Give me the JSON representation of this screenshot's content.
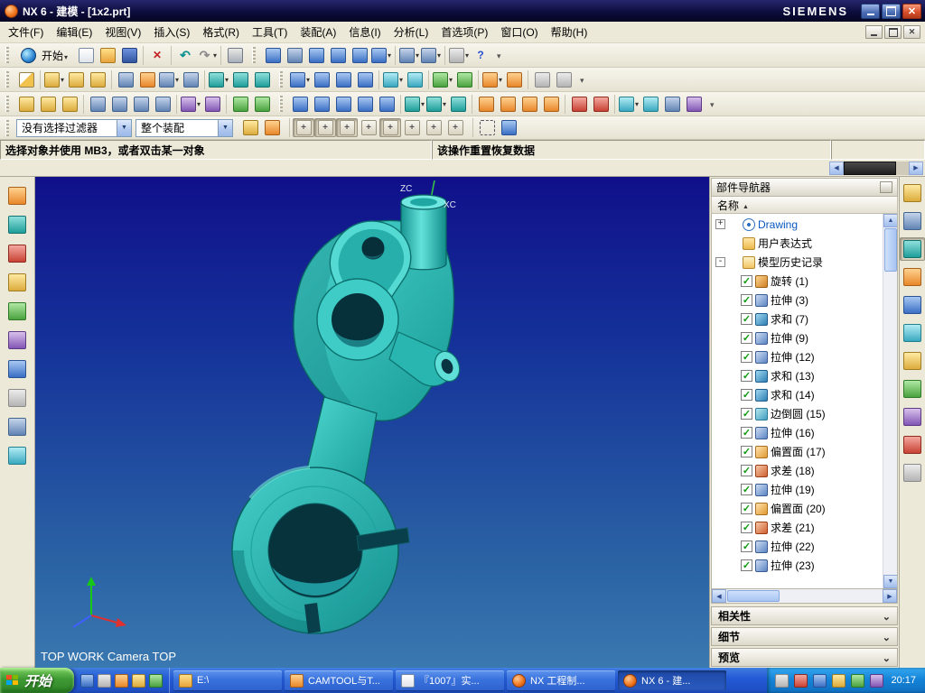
{
  "window": {
    "title": "NX 6 - 建模 - [1x2.prt]",
    "brand": "SIEMENS"
  },
  "menu": {
    "items": [
      "文件(F)",
      "编辑(E)",
      "视图(V)",
      "插入(S)",
      "格式(R)",
      "工具(T)",
      "装配(A)",
      "信息(I)",
      "分析(L)",
      "首选项(P)",
      "窗口(O)",
      "帮助(H)"
    ]
  },
  "toolbars": {
    "start_label": "开始",
    "row1": [
      [
        {
          "name": "new-file-icon",
          "cls": "i-new"
        },
        {
          "name": "open-file-icon",
          "cls": "i-open"
        },
        {
          "name": "save-icon",
          "cls": "i-save"
        }
      ],
      [
        {
          "name": "delete-icon",
          "cls": "i-del"
        }
      ],
      [
        {
          "name": "undo-icon",
          "cls": "i-undo"
        },
        {
          "name": "redo-icon",
          "cls": "i-redo drop"
        }
      ],
      [
        {
          "name": "print-icon",
          "cls": "i-print"
        }
      ],
      [
        {
          "name": "shaded-display-icon",
          "cls": "i-blue"
        },
        {
          "name": "wireframe-display-icon",
          "cls": "i-steel"
        },
        {
          "name": "fit-view-icon",
          "cls": "i-blue"
        },
        {
          "name": "zoom-view-icon",
          "cls": "i-blue"
        },
        {
          "name": "pan-view-icon",
          "cls": "i-blue"
        },
        {
          "name": "rotate-view-icon",
          "cls": "i-blue drop"
        }
      ],
      [
        {
          "name": "front-view-icon",
          "cls": "i-steel drop"
        },
        {
          "name": "isometric-view-icon",
          "cls": "i-steel drop"
        }
      ],
      [
        {
          "name": "window-icon",
          "cls": "i-gray drop"
        },
        {
          "name": "help-icon",
          "cls": "i-help"
        }
      ]
    ],
    "row2": [
      [
        {
          "name": "sketch-icon",
          "cls": "i-sketch"
        }
      ],
      [
        {
          "name": "datum-plane-icon",
          "cls": "i-gold drop"
        },
        {
          "name": "datum-axis-icon",
          "cls": "i-gold"
        },
        {
          "name": "datum-csys-icon",
          "cls": "i-gold"
        }
      ],
      [
        {
          "name": "extrude-icon",
          "cls": "i-steel"
        },
        {
          "name": "revolve-icon",
          "cls": "i-orange"
        },
        {
          "name": "hole-icon",
          "cls": "i-steel drop"
        },
        {
          "name": "boss-icon",
          "cls": "i-steel"
        }
      ],
      [
        {
          "name": "unite-icon",
          "cls": "i-teal drop"
        },
        {
          "name": "subtract-icon",
          "cls": "i-teal"
        },
        {
          "name": "intersect-icon",
          "cls": "i-teal"
        }
      ],
      [
        {
          "name": "edge-blend-icon",
          "cls": "i-blue drop"
        },
        {
          "name": "chamfer-icon",
          "cls": "i-blue"
        },
        {
          "name": "draft-icon",
          "cls": "i-blue"
        },
        {
          "name": "shell-icon",
          "cls": "i-blue"
        }
      ],
      [
        {
          "name": "trim-body-icon",
          "cls": "i-cyan drop"
        },
        {
          "name": "split-body-icon",
          "cls": "i-cyan"
        }
      ],
      [
        {
          "name": "pattern-feature-icon",
          "cls": "i-green drop"
        },
        {
          "name": "mirror-feature-icon",
          "cls": "i-green"
        }
      ],
      [
        {
          "name": "offset-face-icon",
          "cls": "i-orange drop"
        },
        {
          "name": "scale-body-icon",
          "cls": "i-orange"
        }
      ],
      [
        {
          "name": "thread-icon",
          "cls": "i-gray"
        },
        {
          "name": "rib-icon",
          "cls": "i-gray"
        }
      ]
    ],
    "row3": [
      [
        {
          "name": "wcs-dynamics-icon",
          "cls": "i-gold"
        },
        {
          "name": "wcs-orient-icon",
          "cls": "i-gold"
        },
        {
          "name": "wcs-origin-icon",
          "cls": "i-gold"
        }
      ],
      [
        {
          "name": "point-icon",
          "cls": "i-steel"
        },
        {
          "name": "line-icon",
          "cls": "i-steel"
        },
        {
          "name": "arc-icon",
          "cls": "i-steel"
        },
        {
          "name": "rectangle-icon",
          "cls": "i-steel"
        }
      ],
      [
        {
          "name": "measure-distance-icon",
          "cls": "i-purple drop"
        },
        {
          "name": "measure-angle-icon",
          "cls": "i-purple"
        }
      ],
      [
        {
          "name": "layer-settings-icon",
          "cls": "i-green"
        },
        {
          "name": "visible-layers-icon",
          "cls": "i-green"
        }
      ],
      [
        {
          "name": "zoom-in-icon",
          "cls": "i-blue"
        },
        {
          "name": "zoom-out-icon",
          "cls": "i-blue"
        },
        {
          "name": "fit-window-icon",
          "cls": "i-blue"
        },
        {
          "name": "pan-icon",
          "cls": "i-blue"
        },
        {
          "name": "rotate-icon",
          "cls": "i-blue"
        }
      ],
      [
        {
          "name": "shaded-mode-icon",
          "cls": "i-teal drop"
        },
        {
          "name": "wireframe-mode-icon",
          "cls": "i-teal drop"
        },
        {
          "name": "studio-mode-icon",
          "cls": "i-teal"
        }
      ],
      [
        {
          "name": "snap-endpoint-icon",
          "cls": "i-orange"
        },
        {
          "name": "snap-midpoint-icon",
          "cls": "i-orange"
        },
        {
          "name": "snap-center-icon",
          "cls": "i-orange"
        },
        {
          "name": "snap-intersection-icon",
          "cls": "i-orange"
        }
      ],
      [
        {
          "name": "move-object-icon",
          "cls": "i-red"
        },
        {
          "name": "rotate-object-icon",
          "cls": "i-red"
        }
      ],
      [
        {
          "name": "render-style-icon",
          "cls": "i-cyan drop"
        },
        {
          "name": "background-icon",
          "cls": "i-cyan"
        },
        {
          "name": "clip-section-icon",
          "cls": "i-steel"
        },
        {
          "name": "high-quality-image-icon",
          "cls": "i-purple"
        }
      ]
    ]
  },
  "selection_bar": {
    "filter_value": "没有选择过滤器",
    "scope_value": "整个装配",
    "groups": [
      [
        {
          "name": "type-filter-icon",
          "cls": "i-gold"
        },
        {
          "name": "highlight-selection-icon",
          "cls": "i-orange"
        }
      ],
      [
        {
          "name": "snap-point-toggle-icon",
          "cls": "i-snap pressed"
        },
        {
          "name": "snap-endpoint-toggle-icon",
          "cls": "i-snap pressed"
        },
        {
          "name": "snap-midpoint-toggle-icon",
          "cls": "i-snap pressed"
        },
        {
          "name": "snap-control-point-toggle-icon",
          "cls": "i-snap"
        },
        {
          "name": "snap-intersection-toggle-icon",
          "cls": "i-snap pressed"
        },
        {
          "name": "snap-arc-center-toggle-icon",
          "cls": "i-snap"
        },
        {
          "name": "snap-quadrant-toggle-icon",
          "cls": "i-snap"
        },
        {
          "name": "snap-point-on-curve-toggle-icon",
          "cls": "i-snap"
        }
      ],
      [
        {
          "name": "rectangle-select-icon",
          "cls": "i-dash"
        },
        {
          "name": "work-view-icon",
          "cls": "i-blue"
        }
      ]
    ]
  },
  "prompt_bar": {
    "message": "选择对象并使用 MB3，或者双击某一对象",
    "status": "该操作重置恢复数据"
  },
  "left_toolbar": {
    "items": [
      {
        "name": "left-tool-icon-1",
        "cls": "i-orange"
      },
      {
        "name": "left-tool-icon-2",
        "cls": "i-teal"
      },
      {
        "name": "left-tool-icon-3",
        "cls": "i-red"
      },
      {
        "name": "left-tool-icon-4",
        "cls": "i-gold"
      },
      {
        "name": "left-tool-icon-5",
        "cls": "i-green"
      },
      {
        "name": "left-tool-icon-6",
        "cls": "i-purple"
      },
      {
        "name": "left-tool-icon-7",
        "cls": "i-blue"
      },
      {
        "name": "left-tool-icon-8",
        "cls": "i-gray"
      },
      {
        "name": "left-tool-icon-9",
        "cls": "i-steel"
      },
      {
        "name": "left-tool-icon-10",
        "cls": "i-cyan"
      }
    ]
  },
  "viewport": {
    "axis_z": "ZC",
    "axis_x": "XC",
    "view_label": "TOP WORK Camera TOP"
  },
  "part_navigator": {
    "title": "部件导航器",
    "column_header": "名称",
    "tree": [
      {
        "expand": "+",
        "check": "nobox",
        "icon": "f-drawing",
        "iconName": "drawing-icon",
        "label": "Drawing",
        "ind": "ind0",
        "labelCls": "lbl-drawing"
      },
      {
        "expand": "",
        "check": "nobox",
        "icon": "f-folder",
        "iconName": "folder-icon",
        "label": "用户表达式",
        "ind": "ind0"
      },
      {
        "expand": "-",
        "check": "nobox",
        "icon": "f-folder-open",
        "iconName": "folder-open-icon",
        "label": "模型历史记录",
        "ind": "ind0"
      },
      {
        "expand": "",
        "check": "checked",
        "icon": "f-revolve",
        "iconName": "revolve-feature-icon",
        "label": "旋转 (1)",
        "ind": "ind1"
      },
      {
        "expand": "",
        "check": "checked",
        "icon": "f-extrude",
        "iconName": "extrude-feature-icon",
        "label": "拉伸 (3)",
        "ind": "ind1"
      },
      {
        "expand": "",
        "check": "checked",
        "icon": "f-unite",
        "iconName": "unite-feature-icon",
        "label": "求和 (7)",
        "ind": "ind1"
      },
      {
        "expand": "",
        "check": "checked",
        "icon": "f-extrude",
        "iconName": "extrude-feature-icon",
        "label": "拉伸 (9)",
        "ind": "ind1"
      },
      {
        "expand": "",
        "check": "checked",
        "icon": "f-extrude",
        "iconName": "extrude-feature-icon",
        "label": "拉伸 (12)",
        "ind": "ind1"
      },
      {
        "expand": "",
        "check": "checked",
        "icon": "f-unite",
        "iconName": "unite-feature-icon",
        "label": "求和 (13)",
        "ind": "ind1"
      },
      {
        "expand": "",
        "check": "checked",
        "icon": "f-unite",
        "iconName": "unite-feature-icon",
        "label": "求和 (14)",
        "ind": "ind1"
      },
      {
        "expand": "",
        "check": "checked",
        "icon": "f-blend",
        "iconName": "edge-blend-feature-icon",
        "label": "边倒圆 (15)",
        "ind": "ind1"
      },
      {
        "expand": "",
        "check": "checked",
        "icon": "f-extrude",
        "iconName": "extrude-feature-icon",
        "label": "拉伸 (16)",
        "ind": "ind1"
      },
      {
        "expand": "",
        "check": "checked",
        "icon": "f-offset",
        "iconName": "offset-face-feature-icon",
        "label": "偏置面 (17)",
        "ind": "ind1"
      },
      {
        "expand": "",
        "check": "checked",
        "icon": "f-subtract",
        "iconName": "subtract-feature-icon",
        "label": "求差 (18)",
        "ind": "ind1"
      },
      {
        "expand": "",
        "check": "checked",
        "icon": "f-extrude",
        "iconName": "extrude-feature-icon",
        "label": "拉伸 (19)",
        "ind": "ind1"
      },
      {
        "expand": "",
        "check": "checked",
        "icon": "f-offset",
        "iconName": "offset-face-feature-icon",
        "label": "偏置面 (20)",
        "ind": "ind1"
      },
      {
        "expand": "",
        "check": "checked",
        "icon": "f-subtract",
        "iconName": "subtract-feature-icon",
        "label": "求差 (21)",
        "ind": "ind1"
      },
      {
        "expand": "",
        "check": "checked",
        "icon": "f-extrude",
        "iconName": "extrude-feature-icon",
        "label": "拉伸 (22)",
        "ind": "ind1"
      },
      {
        "expand": "",
        "check": "checked",
        "icon": "f-extrude",
        "iconName": "extrude-feature-icon",
        "label": "拉伸 (23)",
        "ind": "ind1"
      }
    ],
    "sections": [
      "相关性",
      "细节",
      "预览"
    ]
  },
  "resource_bar": {
    "items": [
      {
        "name": "assembly-navigator-icon",
        "cls": "i-gold"
      },
      {
        "name": "constraint-navigator-icon",
        "cls": "i-steel"
      },
      {
        "name": "part-navigator-icon",
        "cls": "i-teal pressed"
      },
      {
        "name": "reuse-library-icon",
        "cls": "i-orange"
      },
      {
        "name": "hd3d-tool-icon",
        "cls": "i-blue"
      },
      {
        "name": "web-browser-icon",
        "cls": "i-cyan"
      },
      {
        "name": "history-icon",
        "cls": "i-gold"
      },
      {
        "name": "process-studio-icon",
        "cls": "i-green"
      },
      {
        "name": "manufacturing-wizard-icon",
        "cls": "i-purple"
      },
      {
        "name": "roles-icon",
        "cls": "i-red"
      },
      {
        "name": "system-scenes-icon",
        "cls": "i-gray"
      }
    ]
  },
  "taskbar": {
    "start_label": "开始",
    "time": "20:17",
    "quick_launch": [
      {
        "name": "internet-explorer-icon",
        "cls": "i-blue"
      },
      {
        "name": "show-desktop-icon",
        "cls": "i-gray"
      },
      {
        "name": "media-player-icon",
        "cls": "i-orange"
      },
      {
        "name": "mail-icon",
        "cls": "i-gold"
      },
      {
        "name": "messenger-icon",
        "cls": "i-green"
      }
    ],
    "tasks": [
      {
        "label": "E:\\",
        "icon": "folder-icon",
        "cls": "i-open",
        "state": "inactive"
      },
      {
        "label": "CAMTOOL与T...",
        "icon": "app-icon",
        "cls": "i-orange",
        "state": "inactive"
      },
      {
        "label": "『1007』实...",
        "icon": "document-icon",
        "cls": "i-new",
        "state": "inactive"
      },
      {
        "label": "NX 工程制...",
        "icon": "nx-icon",
        "cls": "i-nx",
        "state": "inactive"
      },
      {
        "label": "NX 6 - 建...",
        "icon": "nx-icon",
        "cls": "i-nx",
        "state": "active"
      }
    ],
    "tray_icons": [
      {
        "name": "ime-icon",
        "cls": "i-gray"
      },
      {
        "name": "antivirus-icon",
        "cls": "i-red"
      },
      {
        "name": "messenger-tray-icon",
        "cls": "i-blue"
      },
      {
        "name": "volume-icon",
        "cls": "i-gold"
      },
      {
        "name": "network-icon",
        "cls": "i-green"
      },
      {
        "name": "security-icon",
        "cls": "i-purple"
      }
    ]
  }
}
